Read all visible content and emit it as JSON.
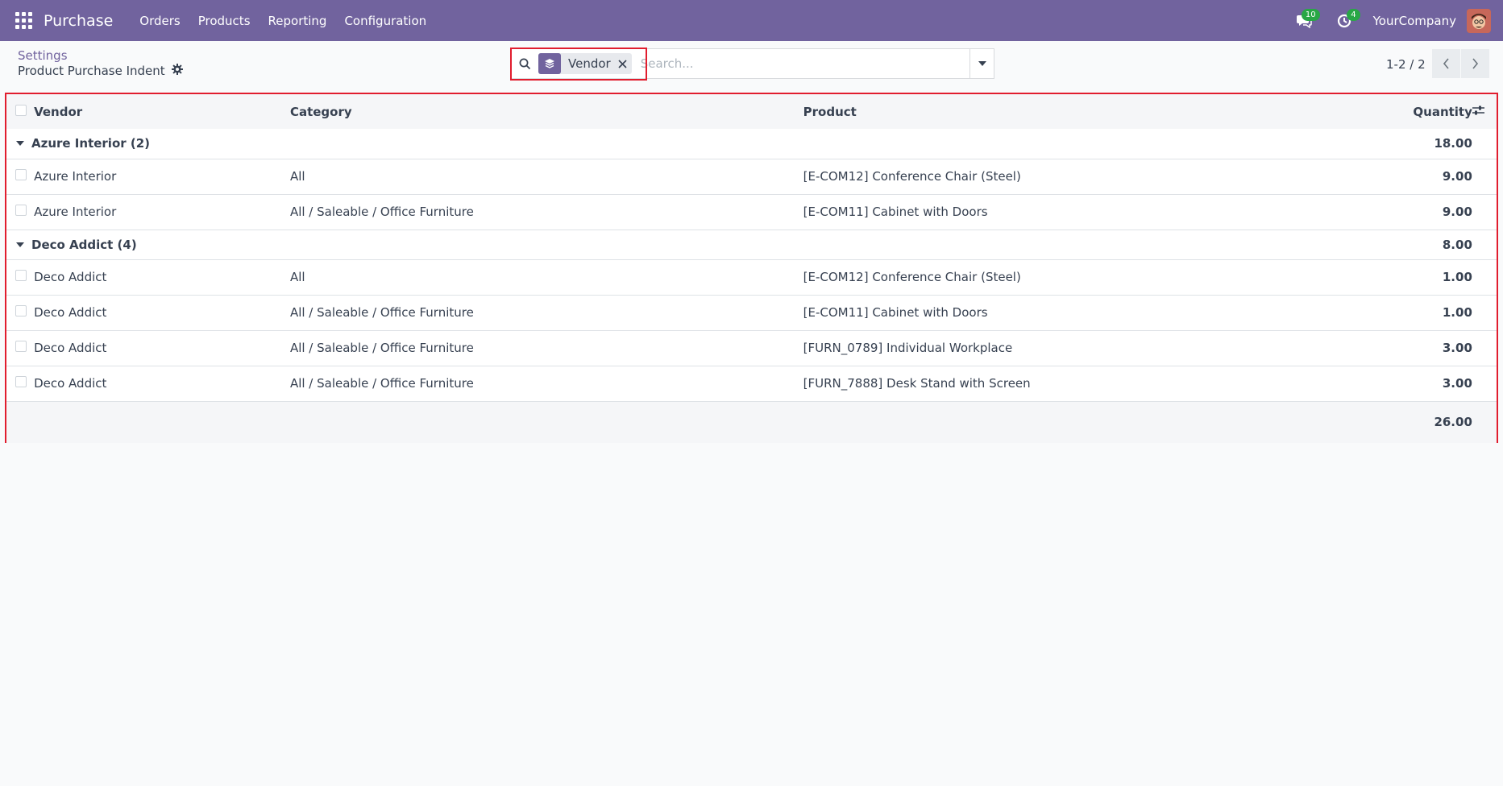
{
  "navbar": {
    "app_name": "Purchase",
    "menu": [
      "Orders",
      "Products",
      "Reporting",
      "Configuration"
    ],
    "messages_count": "10",
    "activities_count": "4",
    "company": "YourCompany",
    "accent_color": "#71639e"
  },
  "control_panel": {
    "breadcrumb": "Settings",
    "title": "Product Purchase Indent",
    "search": {
      "facet_label": "Vendor",
      "placeholder": "Search..."
    },
    "pager": "1-2 / 2"
  },
  "list": {
    "columns": {
      "vendor": "Vendor",
      "category": "Category",
      "product": "Product",
      "quantity": "Quantity"
    },
    "groups": [
      {
        "name": "Azure Interior (2)",
        "total": "18.00",
        "rows": [
          {
            "vendor": "Azure Interior",
            "category": "All",
            "product": "[E-COM12] Conference Chair (Steel)",
            "quantity": "9.00"
          },
          {
            "vendor": "Azure Interior",
            "category": "All / Saleable / Office Furniture",
            "product": "[E-COM11] Cabinet with Doors",
            "quantity": "9.00"
          }
        ]
      },
      {
        "name": "Deco Addict (4)",
        "total": "8.00",
        "rows": [
          {
            "vendor": "Deco Addict",
            "category": "All",
            "product": "[E-COM12] Conference Chair (Steel)",
            "quantity": "1.00"
          },
          {
            "vendor": "Deco Addict",
            "category": "All / Saleable / Office Furniture",
            "product": "[E-COM11] Cabinet with Doors",
            "quantity": "1.00"
          },
          {
            "vendor": "Deco Addict",
            "category": "All / Saleable / Office Furniture",
            "product": "[FURN_0789] Individual Workplace",
            "quantity": "3.00"
          },
          {
            "vendor": "Deco Addict",
            "category": "All / Saleable / Office Furniture",
            "product": "[FURN_7888] Desk Stand with Screen",
            "quantity": "3.00"
          }
        ]
      }
    ],
    "grand_total": "26.00"
  }
}
